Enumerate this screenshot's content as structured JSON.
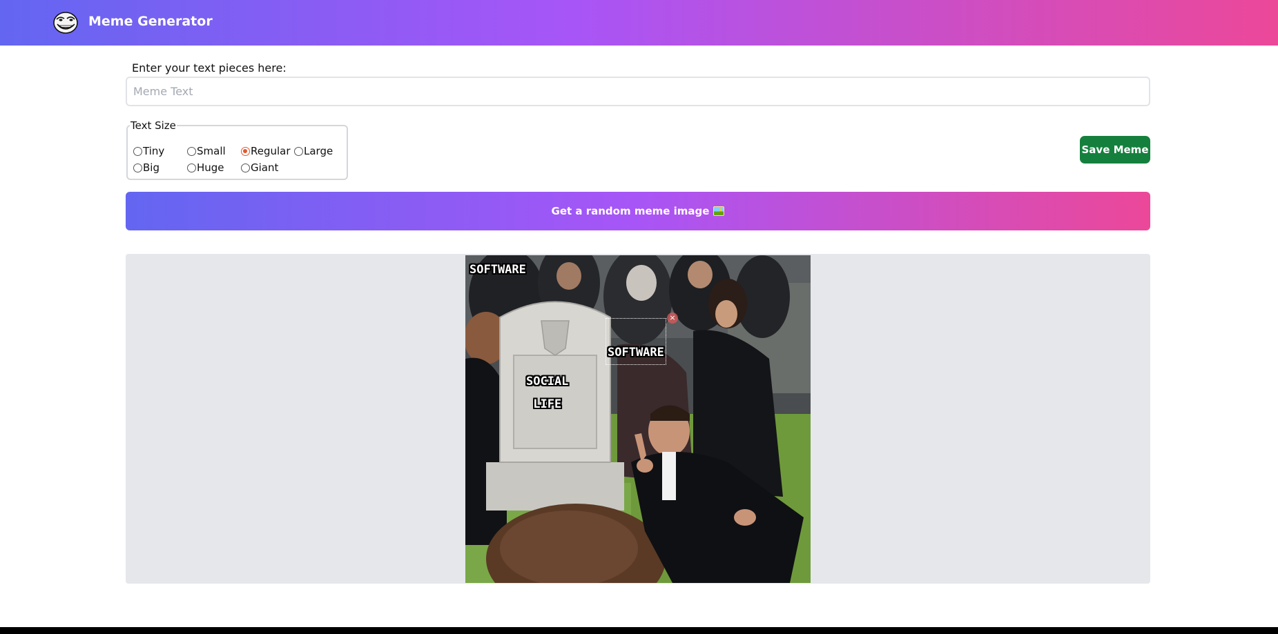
{
  "header": {
    "title": "Meme Generator",
    "logo_icon": "troll-face-icon",
    "gradient": [
      "#6366f1",
      "#a855f7",
      "#ec4899"
    ]
  },
  "form": {
    "input_label": "Enter your text pieces here:",
    "input_placeholder": "Meme Text",
    "input_value": "",
    "size_legend": "Text Size",
    "size_options": [
      "Tiny",
      "Small",
      "Regular",
      "Large",
      "Big",
      "Huge",
      "Giant"
    ],
    "selected_size": "Regular",
    "save_label": "Save Meme",
    "random_label": "Get a random meme image",
    "random_icon": "framed-picture-icon"
  },
  "meme": {
    "texts": [
      {
        "text": "SOFTWARE"
      },
      {
        "text": "SOFTWARE",
        "selected": true,
        "delete_label": "×"
      },
      {
        "text": "SOCIAL\nLIFE"
      }
    ]
  },
  "colors": {
    "save_button": "#15803d",
    "canvas_bg": "#e5e7eb",
    "radio_checked": "#e4572e"
  }
}
